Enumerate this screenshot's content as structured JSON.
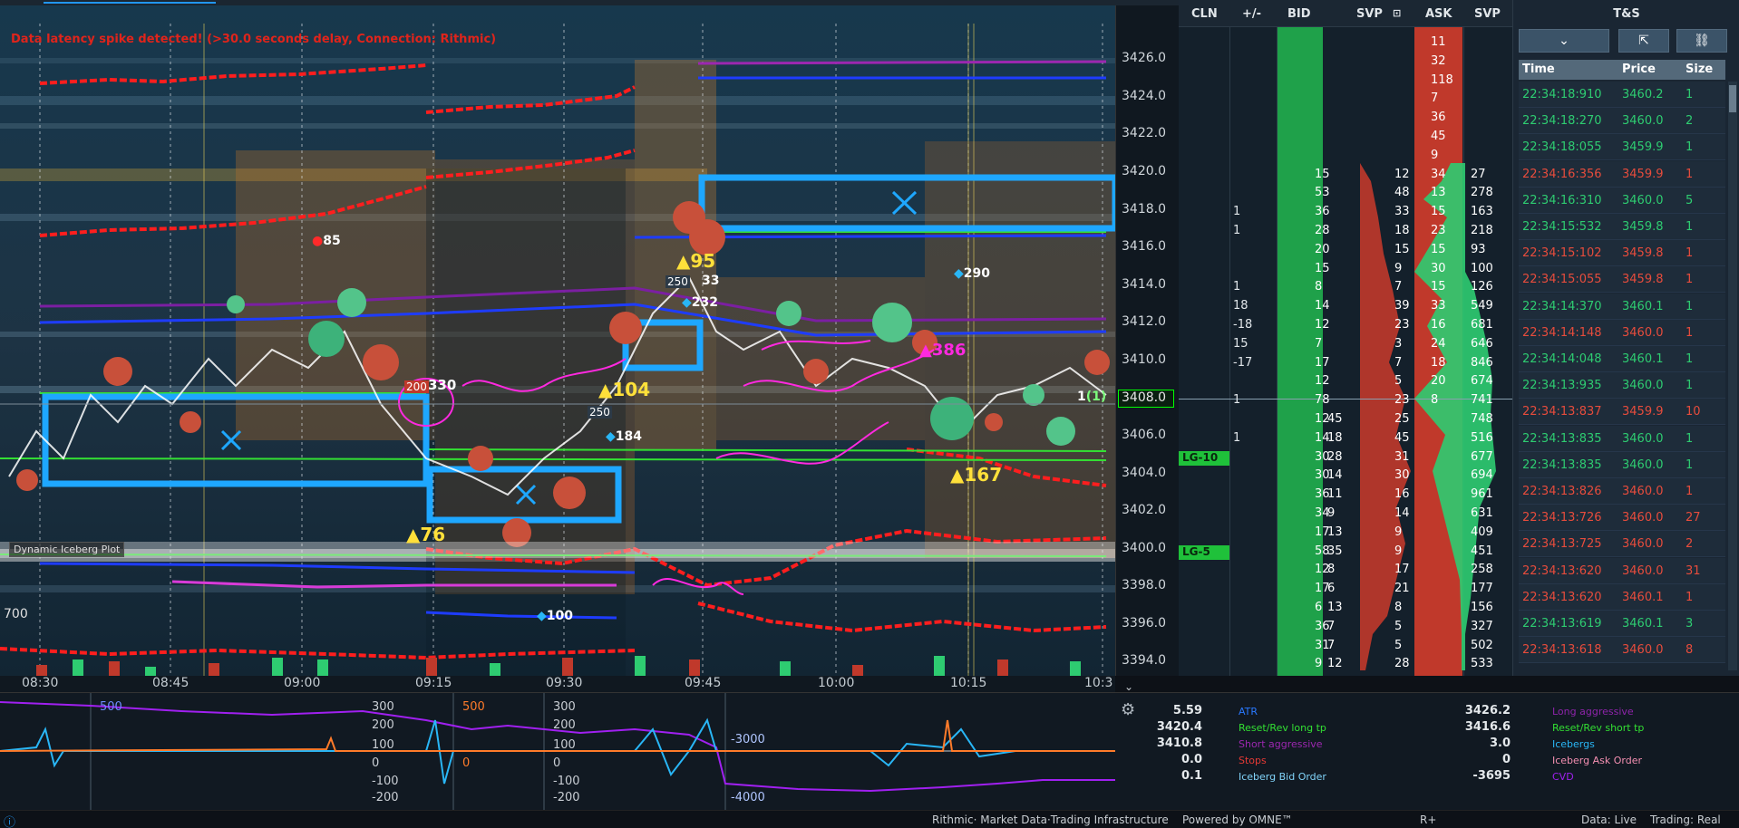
{
  "chart": {
    "warning": "Data latency spike detected! (>30.0 seconds delay, Connection: Rithmic)",
    "iceberg_label": "Dynamic Iceberg Plot",
    "left_value": "700",
    "price_labels": [
      "3426.0",
      "3424.0",
      "3422.0",
      "3420.0",
      "3418.0",
      "3416.0",
      "3414.0",
      "3412.0",
      "3410.0",
      "3408.0",
      "3406.0",
      "3404.0",
      "3402.0",
      "3400.0",
      "3398.0",
      "3396.0",
      "3394.0"
    ],
    "current_price": "3408.0",
    "time_labels": [
      "08:30",
      "08:45",
      "09:00",
      "09:15",
      "09:30",
      "09:45",
      "10:00",
      "10:15",
      "10:3"
    ],
    "markers": {
      "m85": "85",
      "m290": "290",
      "m95": "95",
      "m250a": "250",
      "m33": "33",
      "m232": "232",
      "m200": "200",
      "m330": "330",
      "m104": "104",
      "m250b": "250",
      "m184": "184",
      "m386": "386",
      "m1": "1",
      "m1b": "(1)",
      "m167": "167",
      "m76": "76",
      "m100": "100"
    }
  },
  "sub": {
    "labels": [
      "500",
      "300",
      "200",
      "100",
      "0",
      "-100",
      "-200",
      "500",
      "0",
      "300",
      "200",
      "100",
      "0",
      "-100",
      "-200",
      "-3000",
      "-4000"
    ]
  },
  "ladder": {
    "headers": {
      "cln": "CLN",
      "pm": "+/-",
      "bid": "BID",
      "svp1": "SVP",
      "ask": "ASK",
      "svp2": "SVP"
    },
    "lg10": "LG-10",
    "lg5": "LG-5",
    "rows": [
      {
        "pm": "",
        "bid": "",
        "svpb": "",
        "svpa": "",
        "ask": "11",
        "svp": ""
      },
      {
        "pm": "",
        "bid": "",
        "svpb": "",
        "svpa": "",
        "ask": "32",
        "svp": ""
      },
      {
        "pm": "",
        "bid": "",
        "svpb": "",
        "svpa": "",
        "ask": "118",
        "svp": ""
      },
      {
        "pm": "",
        "bid": "",
        "svpb": "",
        "svpa": "",
        "ask": "7",
        "svp": ""
      },
      {
        "pm": "",
        "bid": "",
        "svpb": "",
        "svpa": "",
        "ask": "36",
        "svp": ""
      },
      {
        "pm": "",
        "bid": "",
        "svpb": "",
        "svpa": "",
        "ask": "45",
        "svp": ""
      },
      {
        "pm": "",
        "bid": "",
        "svpb": "",
        "svpa": "",
        "ask": "9",
        "svp": ""
      },
      {
        "pm": "",
        "bid": "15",
        "svpb": "",
        "svpa": "12",
        "ask": "34",
        "svp": "27"
      },
      {
        "pm": "",
        "bid": "53",
        "svpb": "",
        "svpa": "48",
        "ask": "13",
        "svp": "278"
      },
      {
        "pm": "1",
        "bid": "36",
        "svpb": "",
        "svpa": "33",
        "ask": "15",
        "svp": "163"
      },
      {
        "pm": "1",
        "bid": "28",
        "svpb": "",
        "svpa": "18",
        "ask": "23",
        "svp": "218"
      },
      {
        "pm": "",
        "bid": "20",
        "svpb": "",
        "svpa": "15",
        "ask": "15",
        "svp": "93"
      },
      {
        "pm": "",
        "bid": "15",
        "svpb": "",
        "svpa": "9",
        "ask": "30",
        "svp": "100"
      },
      {
        "pm": "1",
        "bid": "8",
        "svpb": "",
        "svpa": "7",
        "ask": "15",
        "svp": "126"
      },
      {
        "pm": "18",
        "bid": "14",
        "svpb": "",
        "svpa": "39",
        "ask": "33",
        "svp": "549"
      },
      {
        "pm": "-18",
        "bid": "12",
        "svpb": "",
        "svpa": "23",
        "ask": "16",
        "svp": "681"
      },
      {
        "pm": "15",
        "bid": "7",
        "svpb": "",
        "svpa": "3",
        "ask": "24",
        "svp": "646"
      },
      {
        "pm": "-17",
        "bid": "17",
        "svpb": "",
        "svpa": "7",
        "ask": "18",
        "svp": "846"
      },
      {
        "pm": "",
        "bid": "12",
        "svpb": "",
        "svpa": "5",
        "ask": "20",
        "svp": "674"
      },
      {
        "pm": "1",
        "bid": "78",
        "svpb": "",
        "svpa": "23",
        "ask": "8",
        "svp": "741"
      },
      {
        "pm": "",
        "bid": "12",
        "svpb": "45",
        "svpa": "25",
        "ask": "",
        "svp": "748"
      },
      {
        "pm": "1",
        "bid": "14",
        "svpb": "18",
        "svpa": "45",
        "ask": "",
        "svp": "516"
      },
      {
        "pm": "",
        "bid": "30",
        "svpb": "28",
        "svpa": "31",
        "ask": "",
        "svp": "677"
      },
      {
        "pm": "",
        "bid": "30",
        "svpb": "14",
        "svpa": "30",
        "ask": "",
        "svp": "694"
      },
      {
        "pm": "",
        "bid": "36",
        "svpb": "11",
        "svpa": "16",
        "ask": "",
        "svp": "961"
      },
      {
        "pm": "",
        "bid": "34",
        "svpb": "9",
        "svpa": "14",
        "ask": "",
        "svp": "631"
      },
      {
        "pm": "",
        "bid": "17",
        "svpb": "13",
        "svpa": "9",
        "ask": "",
        "svp": "409"
      },
      {
        "pm": "",
        "bid": "58",
        "svpb": "35",
        "svpa": "9",
        "ask": "",
        "svp": "451"
      },
      {
        "pm": "",
        "bid": "12",
        "svpb": "8",
        "svpa": "17",
        "ask": "",
        "svp": "258"
      },
      {
        "pm": "",
        "bid": "17",
        "svpb": "6",
        "svpa": "21",
        "ask": "",
        "svp": "177"
      },
      {
        "pm": "",
        "bid": "6",
        "svpb": "13",
        "svpa": "8",
        "ask": "",
        "svp": "156"
      },
      {
        "pm": "",
        "bid": "36",
        "svpb": "7",
        "svpa": "5",
        "ask": "",
        "svp": "327"
      },
      {
        "pm": "",
        "bid": "31",
        "svpb": "7",
        "svpa": "5",
        "ask": "",
        "svp": "502"
      },
      {
        "pm": "",
        "bid": "9",
        "svpb": "12",
        "svpa": "28",
        "ask": "",
        "svp": "533"
      }
    ]
  },
  "ts": {
    "title": "T&S",
    "headers": {
      "time": "Time",
      "price": "Price",
      "size": "Size"
    },
    "rows": [
      {
        "time": "22:34:18:910",
        "price": "3460.2",
        "size": "1",
        "dir": "up"
      },
      {
        "time": "22:34:18:270",
        "price": "3460.0",
        "size": "2",
        "dir": "up"
      },
      {
        "time": "22:34:18:055",
        "price": "3459.9",
        "size": "1",
        "dir": "up"
      },
      {
        "time": "22:34:16:356",
        "price": "3459.9",
        "size": "1",
        "dir": "dn"
      },
      {
        "time": "22:34:16:310",
        "price": "3460.0",
        "size": "5",
        "dir": "up"
      },
      {
        "time": "22:34:15:532",
        "price": "3459.8",
        "size": "1",
        "dir": "up"
      },
      {
        "time": "22:34:15:102",
        "price": "3459.8",
        "size": "1",
        "dir": "dn"
      },
      {
        "time": "22:34:15:055",
        "price": "3459.8",
        "size": "1",
        "dir": "dn"
      },
      {
        "time": "22:34:14:370",
        "price": "3460.1",
        "size": "1",
        "dir": "up"
      },
      {
        "time": "22:34:14:148",
        "price": "3460.0",
        "size": "1",
        "dir": "dn"
      },
      {
        "time": "22:34:14:048",
        "price": "3460.1",
        "size": "1",
        "dir": "up"
      },
      {
        "time": "22:34:13:935",
        "price": "3460.0",
        "size": "1",
        "dir": "up"
      },
      {
        "time": "22:34:13:837",
        "price": "3459.9",
        "size": "10",
        "dir": "dn"
      },
      {
        "time": "22:34:13:835",
        "price": "3460.0",
        "size": "1",
        "dir": "up"
      },
      {
        "time": "22:34:13:835",
        "price": "3460.0",
        "size": "1",
        "dir": "up"
      },
      {
        "time": "22:34:13:826",
        "price": "3460.0",
        "size": "1",
        "dir": "dn"
      },
      {
        "time": "22:34:13:726",
        "price": "3460.0",
        "size": "27",
        "dir": "dn"
      },
      {
        "time": "22:34:13:725",
        "price": "3460.0",
        "size": "2",
        "dir": "dn"
      },
      {
        "time": "22:34:13:620",
        "price": "3460.0",
        "size": "31",
        "dir": "dn"
      },
      {
        "time": "22:34:13:620",
        "price": "3460.1",
        "size": "1",
        "dir": "dn"
      },
      {
        "time": "22:34:13:619",
        "price": "3460.1",
        "size": "3",
        "dir": "up"
      },
      {
        "time": "22:34:13:618",
        "price": "3460.0",
        "size": "8",
        "dir": "dn"
      }
    ]
  },
  "stats": {
    "left_values": [
      "5.59",
      "3420.4",
      "3410.8",
      "0.0",
      "0.1"
    ],
    "left_keys": [
      {
        "text": "ATR",
        "color": "#2979ff"
      },
      {
        "text": "Reset/Rev long tp",
        "color": "#33e033"
      },
      {
        "text": "Short aggressive",
        "color": "#9c27b0"
      },
      {
        "text": "Stops",
        "color": "#e53935"
      },
      {
        "text": "Iceberg Bid Order",
        "color": "#81d4fa"
      }
    ],
    "right_values": [
      "3426.2",
      "3416.6",
      "3.0",
      "0",
      "-3695"
    ],
    "right_keys": [
      {
        "text": "Long aggressive",
        "color": "#8e24aa"
      },
      {
        "text": "Reset/Rev short tp",
        "color": "#33e033"
      },
      {
        "text": "Icebergs",
        "color": "#29b6f6"
      },
      {
        "text": "Iceberg Ask Order",
        "color": "#f48fb1"
      },
      {
        "text": "CVD",
        "color": "#a020f0"
      }
    ]
  },
  "footer": {
    "rithmic": "Rithmic· Market Data·Trading Infrastructure",
    "omne": "Powered by OMNE™",
    "rplus": "R+",
    "data": "Data: Live",
    "trading": "Trading: Real"
  },
  "colors": {
    "bid": "#1fa14a",
    "ask": "#c0392b",
    "up": "#2ecc71",
    "dn": "#e74c3c"
  }
}
